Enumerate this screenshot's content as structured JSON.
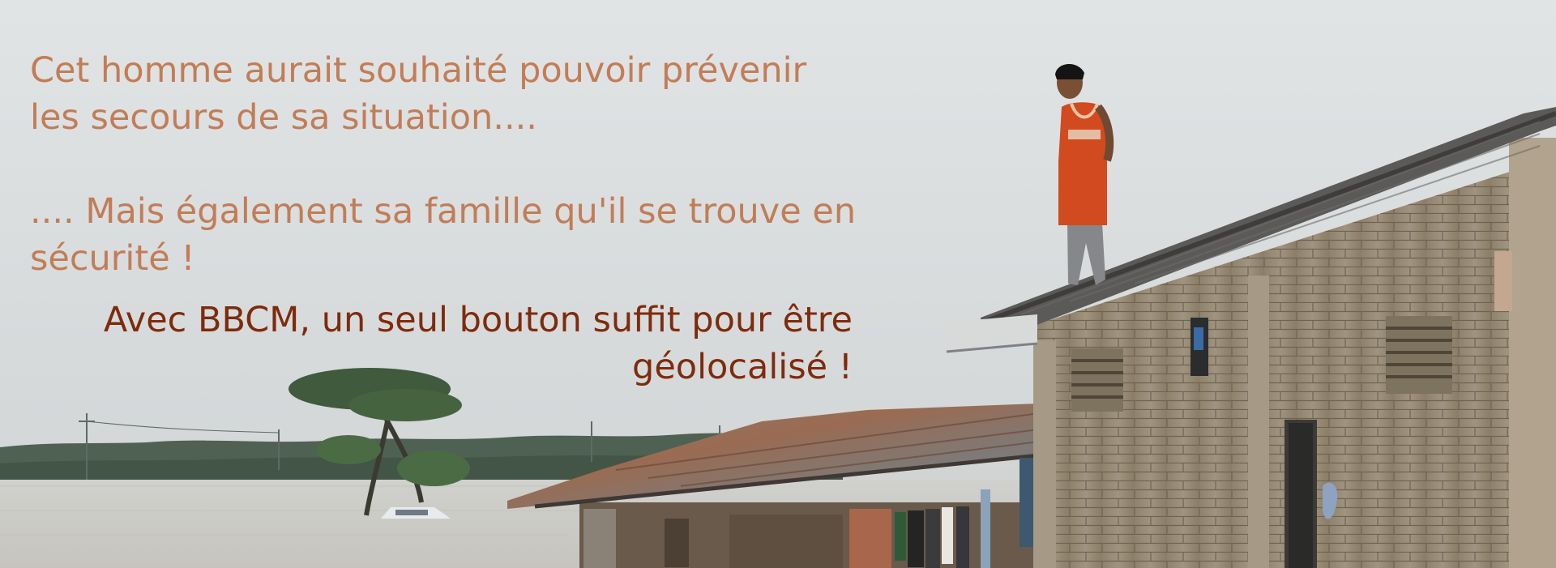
{
  "banner": {
    "paragraph_1": "Cet homme aurait souhaité pouvoir prévenir les secours de sa situation....",
    "paragraph_2": ".... Mais également sa famille qu'il se trouve en sécurité !",
    "tagline": "Avec BBCM, un seul bouton suffit pour être géolocalisé !"
  },
  "colors": {
    "body_text": "#c27d56",
    "tagline_text": "#7e2b0c",
    "sky": "#dde1e2",
    "water": "#cdcdc9",
    "jersey": "#d24a1f"
  }
}
